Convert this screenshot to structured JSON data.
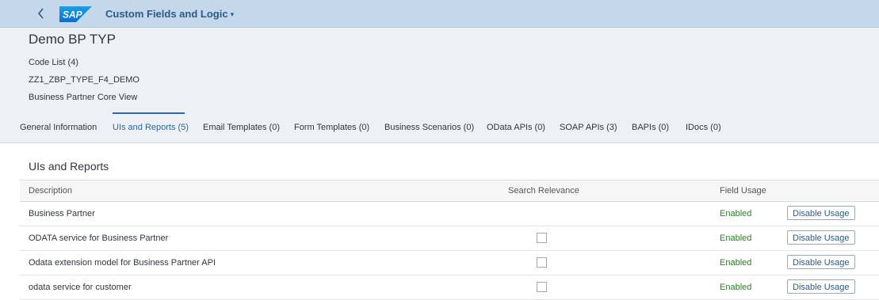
{
  "shell": {
    "logo_text": "SAP",
    "app_title": "Custom Fields and Logic",
    "title_caret": "▾",
    "brand_color": "#0a6ed1"
  },
  "header": {
    "object_title": "Demo BP TYP",
    "attributes": [
      "Code List (4)",
      "ZZ1_ZBP_TYPE_F4_DEMO",
      "Business Partner Core View"
    ]
  },
  "tabs": [
    {
      "label": "General Information",
      "active": false
    },
    {
      "label": "UIs and Reports (5)",
      "active": true
    },
    {
      "label": "Email Templates (0)",
      "active": false
    },
    {
      "label": "Form Templates (0)",
      "active": false
    },
    {
      "label": "Business Scenarios (0)",
      "active": false
    },
    {
      "label": "OData APIs (0)",
      "active": false
    },
    {
      "label": "SOAP APIs (3)",
      "active": false
    },
    {
      "label": "BAPIs (0)",
      "active": false
    },
    {
      "label": "IDocs (0)",
      "active": false
    }
  ],
  "section": {
    "title": "UIs and Reports",
    "columns": {
      "description": "Description",
      "search_relevance": "Search Relevance",
      "field_usage": "Field Usage"
    },
    "rows": [
      {
        "description": "Business Partner",
        "has_checkbox": false,
        "checked": false,
        "status": "Enabled",
        "action": "Disable Usage"
      },
      {
        "description": "ODATA service for Business Partner",
        "has_checkbox": true,
        "checked": false,
        "status": "Enabled",
        "action": "Disable Usage"
      },
      {
        "description": "Odata extension model for Business Partner API",
        "has_checkbox": true,
        "checked": false,
        "status": "Enabled",
        "action": "Disable Usage"
      },
      {
        "description": "odata service for customer",
        "has_checkbox": true,
        "checked": false,
        "status": "Enabled",
        "action": "Disable Usage"
      }
    ]
  }
}
